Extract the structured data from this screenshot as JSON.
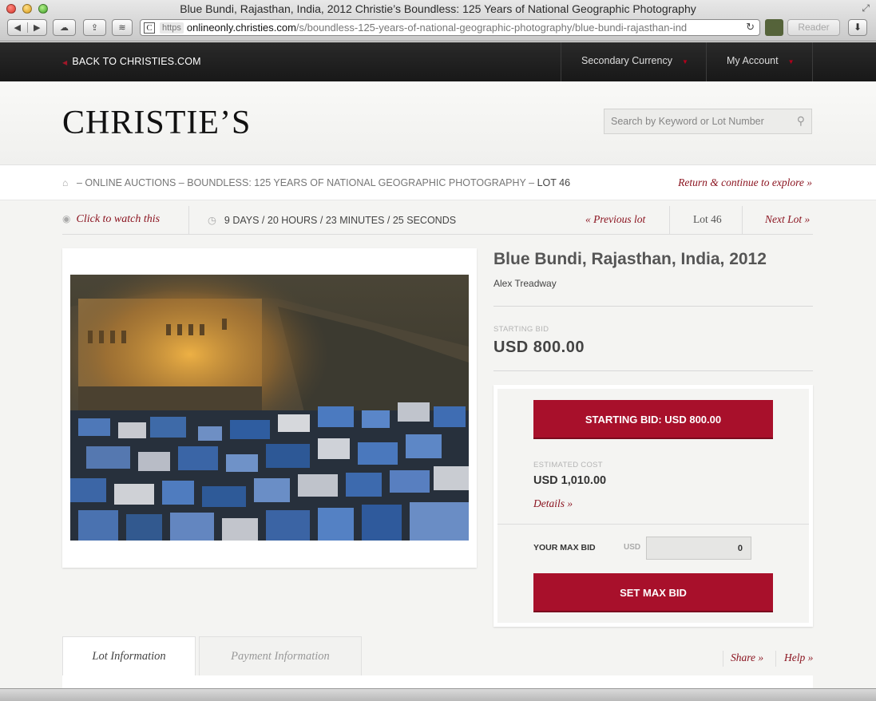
{
  "browser": {
    "window_title": "Blue Bundi, Rajasthan, India, 2012 Christie’s Boundless: 125 Years of National Geographic Photography",
    "https_badge": "https",
    "url_host": "onlineonly.christies.com",
    "url_path": "/s/boundless-125-years-of-national-geographic-photography/blue-bundi-rajasthan-ind",
    "reader_label": "Reader"
  },
  "sitebar": {
    "back_label": "BACK TO CHRISTIES.COM",
    "currency_label": "Secondary Currency",
    "account_label": "My Account"
  },
  "header": {
    "logo": "CHRISTIE’S",
    "search_placeholder": "Search by Keyword or Lot Number"
  },
  "breadcrumb": {
    "trail": "– ONLINE AUCTIONS – BOUNDLESS: 125 YEARS OF NATIONAL GEOGRAPHIC PHOTOGRAPHY –",
    "current": "LOT 46",
    "return_link": "Return & continue to explore »"
  },
  "lotnav": {
    "watch_label": "Click to watch this",
    "countdown": "9 DAYS / 20 HOURS / 23 MINUTES / 25 SECONDS",
    "previous": "« Previous lot",
    "lot_number": "Lot 46",
    "next": "Next Lot »"
  },
  "lot": {
    "title": "Blue Bundi, Rajasthan, India, 2012",
    "artist": "Alex Treadway",
    "starting_bid_label": "STARTING BID",
    "starting_bid_value": "USD 800.00"
  },
  "bidding": {
    "start_button": "STARTING BID: USD 800.00",
    "estimated_cost_label": "ESTIMATED COST",
    "estimated_cost_value": "USD 1,010.00",
    "details_link": "Details »",
    "max_bid_label": "YOUR MAX BID",
    "currency": "USD",
    "max_bid_value": "0",
    "set_max_button": "SET MAX BID"
  },
  "tabs": {
    "lot_information": "Lot Information",
    "payment_information": "Payment Information"
  },
  "links": {
    "share": "Share »",
    "help": "Help »"
  },
  "colors": {
    "accent": "#a8102b",
    "link": "#8b1420",
    "topbar": "#1e1e1e"
  }
}
